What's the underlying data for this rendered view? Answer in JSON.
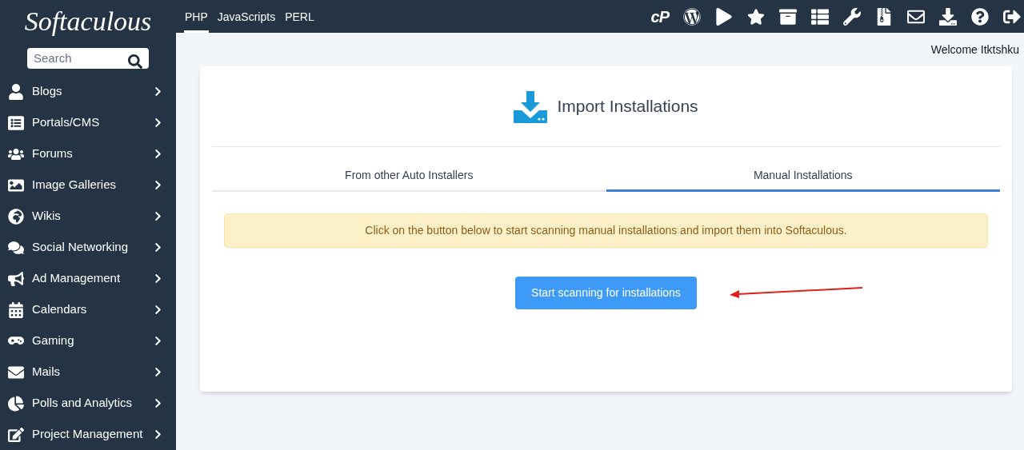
{
  "logo": "Softaculous",
  "search": {
    "placeholder": "Search"
  },
  "sidebar": {
    "items": [
      {
        "label": "Blogs"
      },
      {
        "label": "Portals/CMS"
      },
      {
        "label": "Forums"
      },
      {
        "label": "Image Galleries"
      },
      {
        "label": "Wikis"
      },
      {
        "label": "Social Networking"
      },
      {
        "label": "Ad Management"
      },
      {
        "label": "Calendars"
      },
      {
        "label": "Gaming"
      },
      {
        "label": "Mails"
      },
      {
        "label": "Polls and Analytics"
      },
      {
        "label": "Project Management"
      }
    ]
  },
  "top_tabs": [
    {
      "label": "PHP",
      "selected": true
    },
    {
      "label": "JavaScripts",
      "selected": false
    },
    {
      "label": "PERL",
      "selected": false
    }
  ],
  "cpanel_logo": "cP",
  "welcome": "Welcome Itktshku",
  "card": {
    "title": "Import Installations",
    "tabs": [
      {
        "label": "From other Auto Installers",
        "selected": false
      },
      {
        "label": "Manual Installations",
        "selected": true
      }
    ],
    "notice": "Click on the button below to start scanning manual installations and import them into Softaculous.",
    "button": "Start scanning for installations"
  }
}
